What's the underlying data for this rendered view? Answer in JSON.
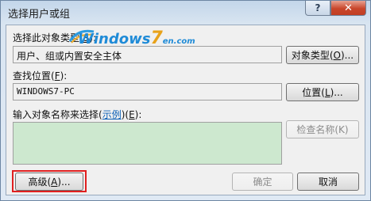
{
  "window": {
    "title": "选择用户或组",
    "help_label": "?",
    "close_label": "✕"
  },
  "object_type": {
    "label_prefix": "选择此对象类型(",
    "label_key": "S",
    "label_suffix": "):",
    "value": "用户、组或内置安全主体",
    "button_prefix": "对象类型(",
    "button_key": "O",
    "button_suffix": ")..."
  },
  "location": {
    "label_prefix": "查找位置(",
    "label_key": "F",
    "label_suffix": "):",
    "value": "WINDOWS7-PC",
    "button_prefix": "位置(",
    "button_key": "L",
    "button_suffix": ")..."
  },
  "object_names": {
    "label_prefix": "输入对象名称来选择(",
    "label_link": "示例",
    "label_suffix_prefix": ")(",
    "label_key": "E",
    "label_suffix": "):",
    "value": "",
    "check_names_label": "检查名称(K)"
  },
  "footer": {
    "advanced_prefix": "高级(",
    "advanced_key": "A",
    "advanced_suffix": ")...",
    "ok_label": "确定",
    "cancel_label": "取消"
  },
  "watermark": {
    "text_a": "Windows",
    "text_seven": "7",
    "text_en": "en",
    "text_b": ".com"
  },
  "colors": {
    "highlight": "#e02020",
    "textarea_bg": "#cde8cf",
    "close_button": "#c9462b",
    "link": "#0b5fb5"
  }
}
